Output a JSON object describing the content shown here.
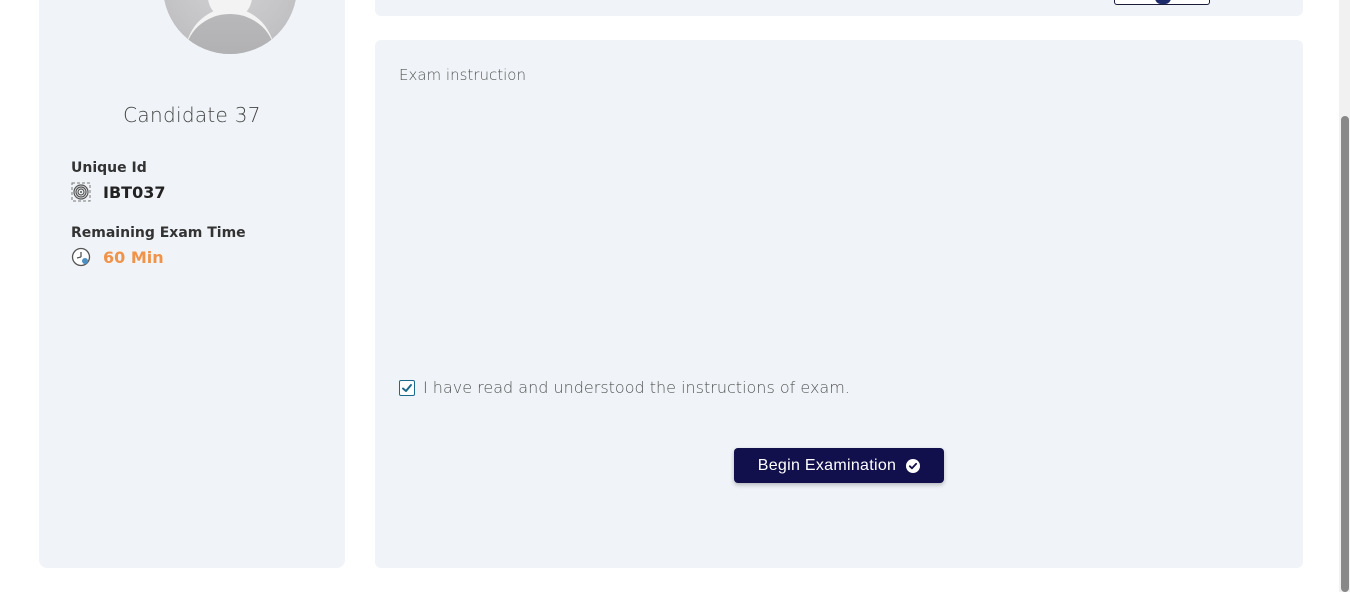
{
  "candidate": {
    "name": "Candidate 37",
    "unique_id_label": "Unique Id",
    "unique_id_value": "IBT037",
    "remaining_time_label": "Remaining Exam Time",
    "remaining_time_value": "60 Min"
  },
  "instructions": {
    "title": "Exam instruction",
    "acknowledgement_text": "I have read and understood the instructions of exam.",
    "acknowledged": true
  },
  "actions": {
    "begin_label": "Begin Examination"
  },
  "colors": {
    "card_background": "#f0f4f8",
    "button_background": "#11104d",
    "time_accent": "#f0934a",
    "checkbox_accent": "#1a6a8c"
  },
  "icons": {
    "unique_id": "fingerprint-icon",
    "time": "clock-icon",
    "begin": "check-circle-icon"
  }
}
